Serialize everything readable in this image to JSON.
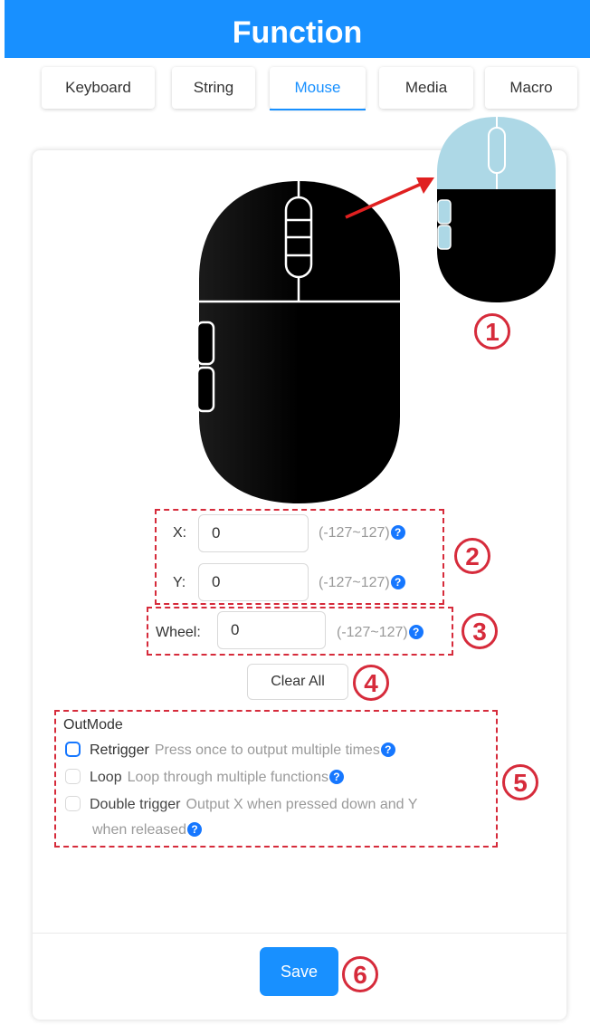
{
  "header": {
    "title": "Function"
  },
  "tabs": [
    {
      "label": "Keyboard"
    },
    {
      "label": "String"
    },
    {
      "label": "Mouse"
    },
    {
      "label": "Media"
    },
    {
      "label": "Macro"
    }
  ],
  "active_tab": "Mouse",
  "movement": {
    "x": {
      "label": "X:",
      "value": "0",
      "range": "(-127~127)"
    },
    "y": {
      "label": "Y:",
      "value": "0",
      "range": "(-127~127)"
    }
  },
  "wheel": {
    "label": "Wheel:",
    "value": "0",
    "range": "(-127~127)"
  },
  "help_glyph": "?",
  "clear_all_label": "Clear All",
  "outmode": {
    "title": "OutMode",
    "options": [
      {
        "name": "Retrigger",
        "desc": "Press once to output multiple times",
        "checked": false,
        "enabled": true
      },
      {
        "name": "Loop",
        "desc": "Loop through multiple functions",
        "checked": false,
        "enabled": false
      },
      {
        "name": "Double trigger",
        "desc": "Output X when pressed down and Y",
        "desc2": "when released",
        "checked": false,
        "enabled": false
      }
    ]
  },
  "save_label": "Save",
  "callouts": [
    "1",
    "2",
    "3",
    "4",
    "5",
    "6"
  ],
  "colors": {
    "header_bg": "#1890ff",
    "accent": "#1677ff",
    "callout": "#d62b3b",
    "mouse_body": "#000000",
    "mouse_highlight": "#add8e6"
  },
  "icons": [
    "mouse-icon",
    "mouse-highlight-icon",
    "arrow-icon",
    "help-icon",
    "checkbox-icon"
  ]
}
